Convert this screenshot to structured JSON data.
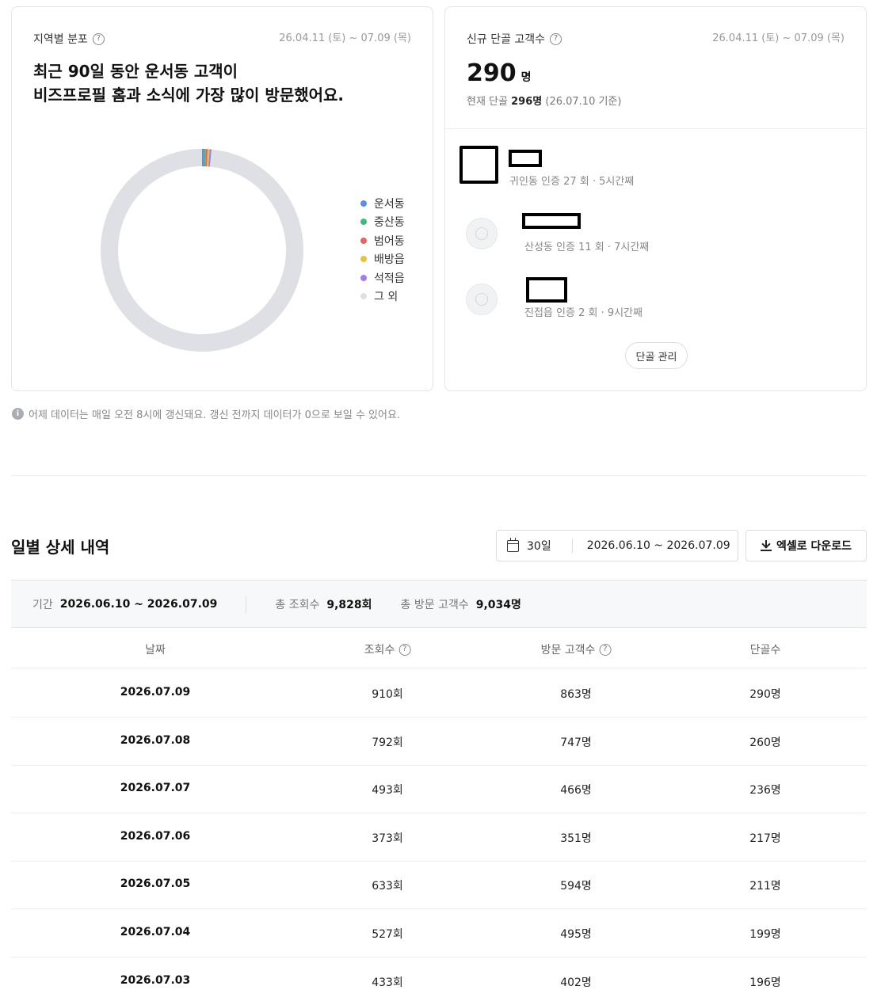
{
  "region_card": {
    "title": "지역별 분포",
    "period": "26.04.11 (토) ~ 07.09 (목)",
    "headline_line1": "최근 90일 동안 운서동 고객이",
    "headline_line2": "비즈프로필 홈과 소식에 가장 많이 방문했어요.",
    "legend": [
      {
        "label": "운서동",
        "color": "#5b8def"
      },
      {
        "label": "중산동",
        "color": "#3dbb7e"
      },
      {
        "label": "범어동",
        "color": "#ef6161"
      },
      {
        "label": "배방읍",
        "color": "#e8c23a"
      },
      {
        "label": "석적읍",
        "color": "#a07df0"
      },
      {
        "label": "그 외",
        "color": "#dfe0e5"
      }
    ]
  },
  "chart_data": {
    "type": "pie",
    "labels": [
      "운서동",
      "중산동",
      "범어동",
      "배방읍",
      "석적읍",
      "그 외"
    ],
    "values": [
      0.3,
      0.3,
      0.3,
      0.3,
      0.3,
      98.5
    ],
    "colors": [
      "#5b8def",
      "#3dbb7e",
      "#ef6161",
      "#e8c23a",
      "#a07df0",
      "#dfe0e5"
    ],
    "title": "",
    "legend": "right"
  },
  "regular_card": {
    "title": "신규 단골 고객수",
    "period": "26.04.11 (토) ~ 07.09 (목)",
    "count": "290",
    "unit": "명",
    "current_label": "현재 단골",
    "current_value": "296명",
    "current_date": "(26.07.10 기준)",
    "customers": [
      {
        "meta": "귀인동 인증 27 회 · 5시간째"
      },
      {
        "meta": "산성동 인증 11 회 · 7시간째"
      },
      {
        "meta": "진접읍 인증 2 회 · 9시간째"
      }
    ],
    "manage_button": "단골 관리"
  },
  "notice": {
    "icon": "info-icon",
    "text": "어제 데이터는 매일 오전 8시에 갱신돼요. 갱신 전까지 데이터가 0으로 보일 수 있어요."
  },
  "daily": {
    "title": "일별 상세 내역",
    "period_select": "30일",
    "date_range": "2026.06.10 ~ 2026.07.09",
    "excel_button": "엑셀로 다운로드",
    "summary": {
      "period_label": "기간",
      "period_value": "2026.06.10 ~ 2026.07.09",
      "views_label": "총 조회수",
      "views_value": "9,828회",
      "visitors_label": "총 방문 고객수",
      "visitors_value": "9,034명"
    },
    "headers": {
      "date": "날짜",
      "views": "조회수",
      "visitors": "방문 고객수",
      "regulars": "단골수"
    },
    "rows": [
      {
        "date": "2026.07.09",
        "views": "910회",
        "visitors": "863명",
        "regulars": "290명"
      },
      {
        "date": "2026.07.08",
        "views": "792회",
        "visitors": "747명",
        "regulars": "260명"
      },
      {
        "date": "2026.07.07",
        "views": "493회",
        "visitors": "466명",
        "regulars": "236명"
      },
      {
        "date": "2026.07.06",
        "views": "373회",
        "visitors": "351명",
        "regulars": "217명"
      },
      {
        "date": "2026.07.05",
        "views": "633회",
        "visitors": "594명",
        "regulars": "211명"
      },
      {
        "date": "2026.07.04",
        "views": "527회",
        "visitors": "495명",
        "regulars": "199명"
      },
      {
        "date": "2026.07.03",
        "views": "433회",
        "visitors": "402명",
        "regulars": "196명"
      }
    ]
  }
}
